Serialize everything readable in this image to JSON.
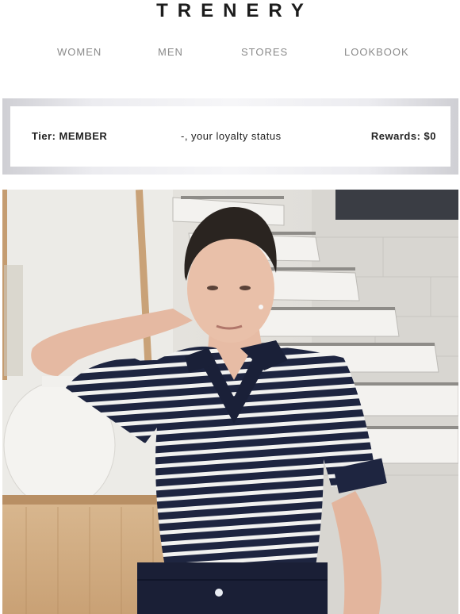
{
  "brand": {
    "logo_text": "TRENERY"
  },
  "nav": {
    "items": [
      {
        "label": "WOMEN"
      },
      {
        "label": "MEN"
      },
      {
        "label": "STORES"
      },
      {
        "label": "LOOKBOOK"
      }
    ]
  },
  "loyalty": {
    "tier": "Tier: MEMBER",
    "status": "-, your loyalty status",
    "rewards": "Rewards: $0"
  },
  "colors": {
    "brand_text": "#1c1c1c",
    "nav_text": "#8a8a8a",
    "knit_navy": "#1e2540",
    "background": "#ffffff"
  }
}
